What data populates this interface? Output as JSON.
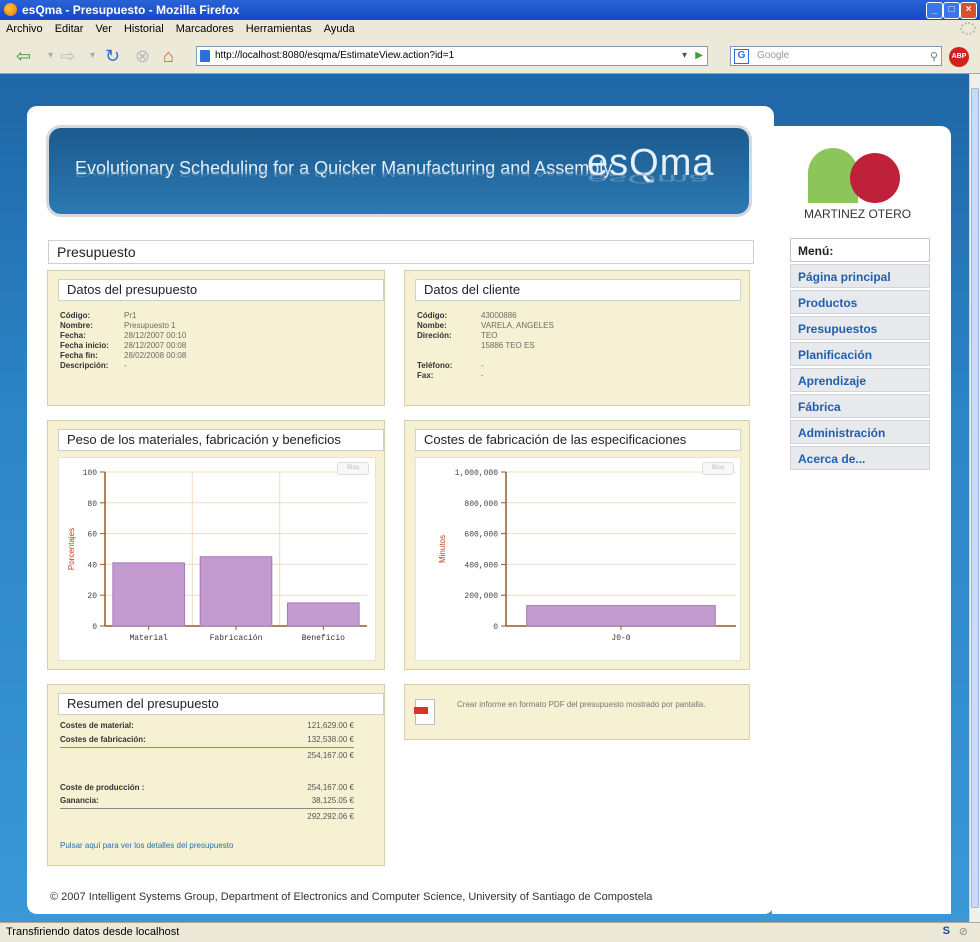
{
  "browser": {
    "window_title": "esQma - Presupuesto - Mozilla Firefox",
    "menu": [
      "Archivo",
      "Editar",
      "Ver",
      "Historial",
      "Marcadores",
      "Herramientas",
      "Ayuda"
    ],
    "url": "http://localhost:8080/esqma/EstimateView.action?id=1",
    "search_engine": "Google",
    "abp_label": "ABP",
    "status": "Transfiriendo datos desde localhost",
    "status_s": "S",
    "status_o": "⊘",
    "btn_min": "_",
    "btn_max": "□",
    "btn_close": "×"
  },
  "banner": {
    "tagline": "Evolutionary Scheduling for a Quicker Manufacturing and Assembly",
    "logo": "esQma"
  },
  "page_title": "Presupuesto",
  "estimate": {
    "heading": "Datos del presupuesto",
    "rows": [
      {
        "label": "Código:",
        "value": "Pr1"
      },
      {
        "label": "Nombre:",
        "value": "Presupuesto 1"
      },
      {
        "label": "Fecha:",
        "value": "28/12/2007 00:10"
      },
      {
        "label": "Fecha inicio:",
        "value": "28/12/2007 00:08"
      },
      {
        "label": "Fecha fin:",
        "value": "28/02/2008 00:08"
      },
      {
        "label": "Descripción:",
        "value": "-"
      }
    ]
  },
  "client": {
    "heading": "Datos del cliente",
    "rows": [
      {
        "label": "Código:",
        "value": "43000886"
      },
      {
        "label": "Nombe:",
        "value": "VARELA, ANGELES"
      },
      {
        "label": "Direción:",
        "value": "TEO"
      },
      {
        "label": "",
        "value": "15886 TEO ES"
      },
      {
        "label": "",
        "value": ""
      },
      {
        "label": "Teléfono:",
        "value": "-"
      },
      {
        "label": "Fax:",
        "value": "-"
      }
    ]
  },
  "chart1": {
    "heading": "Peso de los materiales, fabricación y beneficios",
    "chip": "Bloq"
  },
  "chart2": {
    "heading": "Costes de fabricación de las especificaciones",
    "chip": "Bloq"
  },
  "chart_data": [
    {
      "type": "bar",
      "categories": [
        "Material",
        "Fabricación",
        "Beneficio"
      ],
      "values": [
        41,
        45,
        15
      ],
      "ylabel": "Porcentajes",
      "ylim": [
        0,
        100
      ],
      "yticks": [
        0,
        20,
        40,
        60,
        80,
        100
      ],
      "ytick_labels": [
        "0",
        "20",
        "40",
        "60",
        "80",
        "100"
      ],
      "bar_color": "#c39bd1",
      "grid": true
    },
    {
      "type": "bar",
      "categories": [
        "J0-0"
      ],
      "values": [
        132538
      ],
      "ylabel": "Minutos",
      "ylim": [
        0,
        1000000
      ],
      "yticks": [
        0,
        200000,
        400000,
        600000,
        800000,
        1000000
      ],
      "ytick_labels": [
        "0",
        "200,000",
        "400,000",
        "600,000",
        "800,000",
        "1,000,000"
      ],
      "bar_color": "#c39bd1",
      "grid": true
    }
  ],
  "summary": {
    "heading": "Resumen del presupuesto",
    "material_label": "Costes de material:",
    "material_value": "121,629.00 €",
    "fab_label": "Costes de fabricación:",
    "fab_value": "132,538.00 €",
    "subtotal": "254,167.00 €",
    "prod_label": "Coste de producción :",
    "prod_value": "254,167.00 €",
    "gain_label": "Ganancia:",
    "gain_value": "38,125.05 €",
    "total": "292,292.06 €",
    "details_link": "Pulsar aquí para ver los detalles del presupuesto"
  },
  "pdf": {
    "text": "Crear informe en formato PDF del presupuesto mostrado por pantalla."
  },
  "footer": "© 2007 Intelligent Systems Group, Department of Electronics and Computer Science, University of Santiago de Compostela",
  "company": "MARTINEZ OTERO",
  "menu": {
    "header": "Menú:",
    "items": [
      "Página principal",
      "Productos",
      "Presupuestos",
      "Planificación",
      "Aprendizaje",
      "Fábrica",
      "Administración",
      "Acerca de..."
    ]
  }
}
